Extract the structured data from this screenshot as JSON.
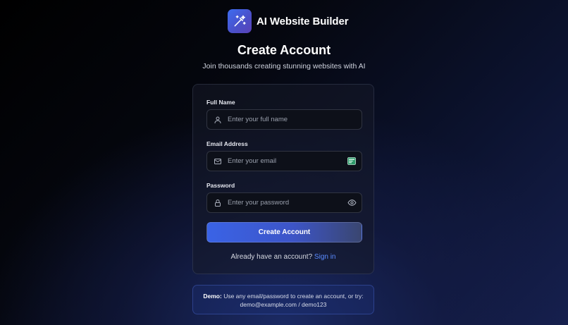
{
  "brand": {
    "name": "AI Website Builder",
    "icon": "magic-wand-icon"
  },
  "header": {
    "title": "Create Account",
    "subtitle": "Join thousands creating stunning websites with AI"
  },
  "form": {
    "full_name": {
      "label": "Full Name",
      "placeholder": "Enter your full name",
      "value": "",
      "icon": "user-icon"
    },
    "email": {
      "label": "Email Address",
      "placeholder": "Enter your email",
      "value": "",
      "icon": "mail-icon",
      "trailing_icon": "autofill-card-icon"
    },
    "password": {
      "label": "Password",
      "placeholder": "Enter your password",
      "value": "",
      "icon": "lock-icon",
      "trailing_icon": "eye-icon"
    },
    "submit_label": "Create Account"
  },
  "signin": {
    "prompt": "Already have an account?",
    "link_label": "Sign in"
  },
  "demo": {
    "lead": "Demo:",
    "text": "Use any email/password to create an account, or try:",
    "credentials": "demo@example.com / demo123"
  },
  "colors": {
    "accent": "#3a63e6",
    "link": "#5a8bff",
    "background": "#05070f"
  }
}
